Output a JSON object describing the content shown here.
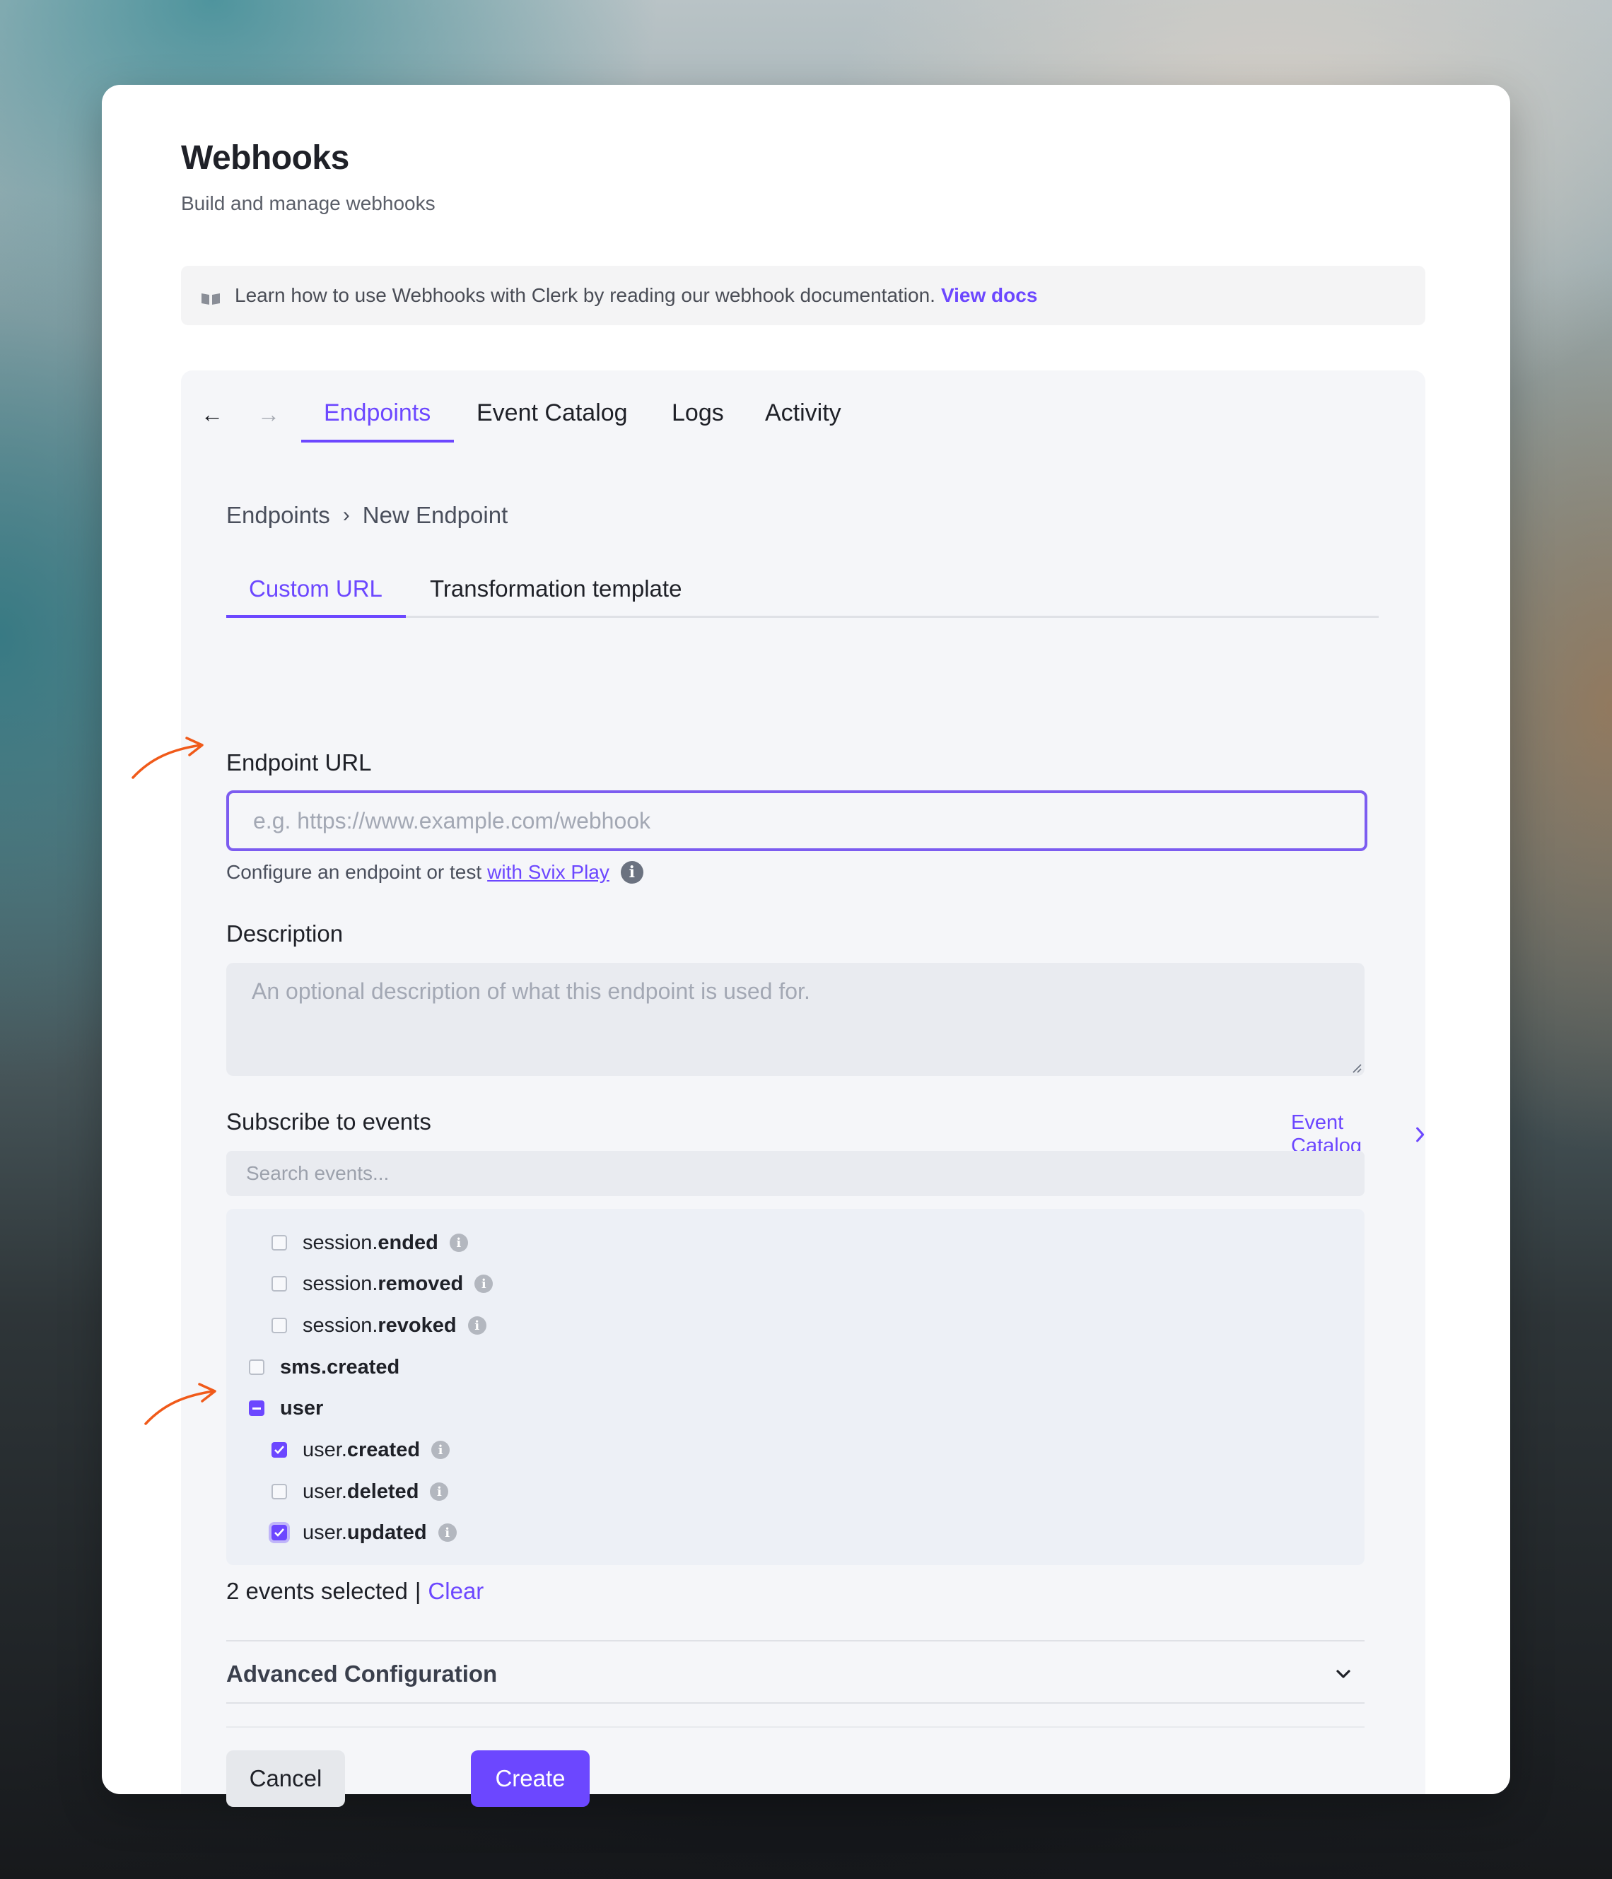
{
  "header": {
    "title": "Webhooks",
    "subtitle": "Build and manage webhooks"
  },
  "banner": {
    "text": "Learn how to use Webhooks with Clerk by reading our webhook documentation.",
    "link_label": "View docs",
    "icon": "book-icon"
  },
  "main_tabs": [
    {
      "label": "Endpoints",
      "active": true
    },
    {
      "label": "Event Catalog",
      "active": false
    },
    {
      "label": "Logs",
      "active": false
    },
    {
      "label": "Activity",
      "active": false
    }
  ],
  "breadcrumb": {
    "root": "Endpoints",
    "separator": "›",
    "current": "New Endpoint"
  },
  "sub_tabs": [
    {
      "label": "Custom URL",
      "active": true
    },
    {
      "label": "Transformation template",
      "active": false
    }
  ],
  "endpoint_url": {
    "label": "Endpoint URL",
    "value": "",
    "placeholder": "e.g. https://www.example.com/webhook",
    "helper_text": "Configure an endpoint or test",
    "helper_link": "with Svix Play"
  },
  "description": {
    "label": "Description",
    "value": "",
    "placeholder": "An optional description of what this endpoint is used for."
  },
  "events": {
    "label": "Subscribe to events",
    "catalog_link": "Event Catalog",
    "search_placeholder": "Search events...",
    "items": [
      {
        "prefix": "session.",
        "name": "ended",
        "checked": false,
        "child": true
      },
      {
        "prefix": "session.",
        "name": "removed",
        "checked": false,
        "child": true
      },
      {
        "prefix": "session.",
        "name": "revoked",
        "checked": false,
        "child": true
      },
      {
        "prefix": "",
        "name": "sms.created",
        "checked": false,
        "child": false
      },
      {
        "prefix": "",
        "name": "user",
        "checked": "partial",
        "child": false
      },
      {
        "prefix": "user.",
        "name": "created",
        "checked": true,
        "child": true
      },
      {
        "prefix": "user.",
        "name": "deleted",
        "checked": false,
        "child": true
      },
      {
        "prefix": "user.",
        "name": "updated",
        "checked": true,
        "child": true
      }
    ],
    "selected_text": "2 events selected",
    "pipe": "|",
    "clear_label": "Clear"
  },
  "advanced": {
    "label": "Advanced Configuration"
  },
  "actions": {
    "cancel_label": "Cancel",
    "create_label": "Create"
  },
  "colors": {
    "accent": "#6c47ff",
    "annotation": "#f05a1a"
  }
}
